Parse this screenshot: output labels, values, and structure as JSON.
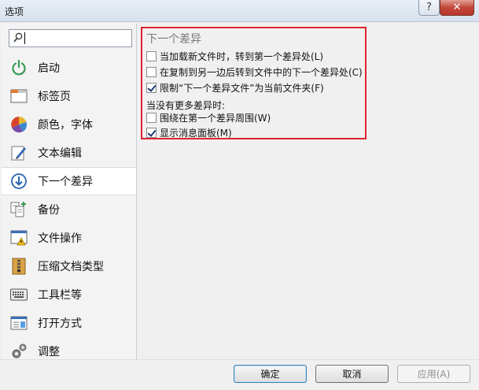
{
  "window": {
    "title": "选项",
    "help_label": "?",
    "close_label": "✕"
  },
  "sidebar": {
    "search": {
      "value": "",
      "placeholder": ""
    },
    "items": [
      {
        "label": "启动",
        "icon": "power-icon"
      },
      {
        "label": "标签页",
        "icon": "tab-window-icon"
      },
      {
        "label": "颜色，字体",
        "icon": "palette-icon"
      },
      {
        "label": "文本编辑",
        "icon": "pencil-edit-icon"
      },
      {
        "label": "下一个差异",
        "icon": "arrow-down-circle-icon",
        "active": true
      },
      {
        "label": "备份",
        "icon": "backup-copy-icon"
      },
      {
        "label": "文件操作",
        "icon": "file-warning-icon"
      },
      {
        "label": "压缩文档类型",
        "icon": "archive-zipper-icon"
      },
      {
        "label": "工具栏等",
        "icon": "keyboard-icon"
      },
      {
        "label": "打开方式",
        "icon": "open-with-icon"
      },
      {
        "label": "调整",
        "icon": "gears-icon"
      }
    ]
  },
  "next_diff": {
    "title": "下一个差异",
    "options": [
      {
        "label": "当加载新文件时，转到第一个差异处(L)",
        "checked": false
      },
      {
        "label": "在复制到另一边后转到文件中的下一个差异处(C)",
        "checked": false
      },
      {
        "label": "限制“下一个差异文件”为当前文件夹(F)",
        "checked": true
      }
    ],
    "subheading": "当没有更多差异时:",
    "sub_options": [
      {
        "label": "围绕在第一个差异周围(W)",
        "checked": false
      },
      {
        "label": "显示消息面板(M)",
        "checked": true
      }
    ]
  },
  "buttons": {
    "ok": "确定",
    "cancel": "取消",
    "apply": "应用(A)"
  },
  "colors": {
    "highlight_border": "#e0232e",
    "close_button": "#c2473a"
  }
}
